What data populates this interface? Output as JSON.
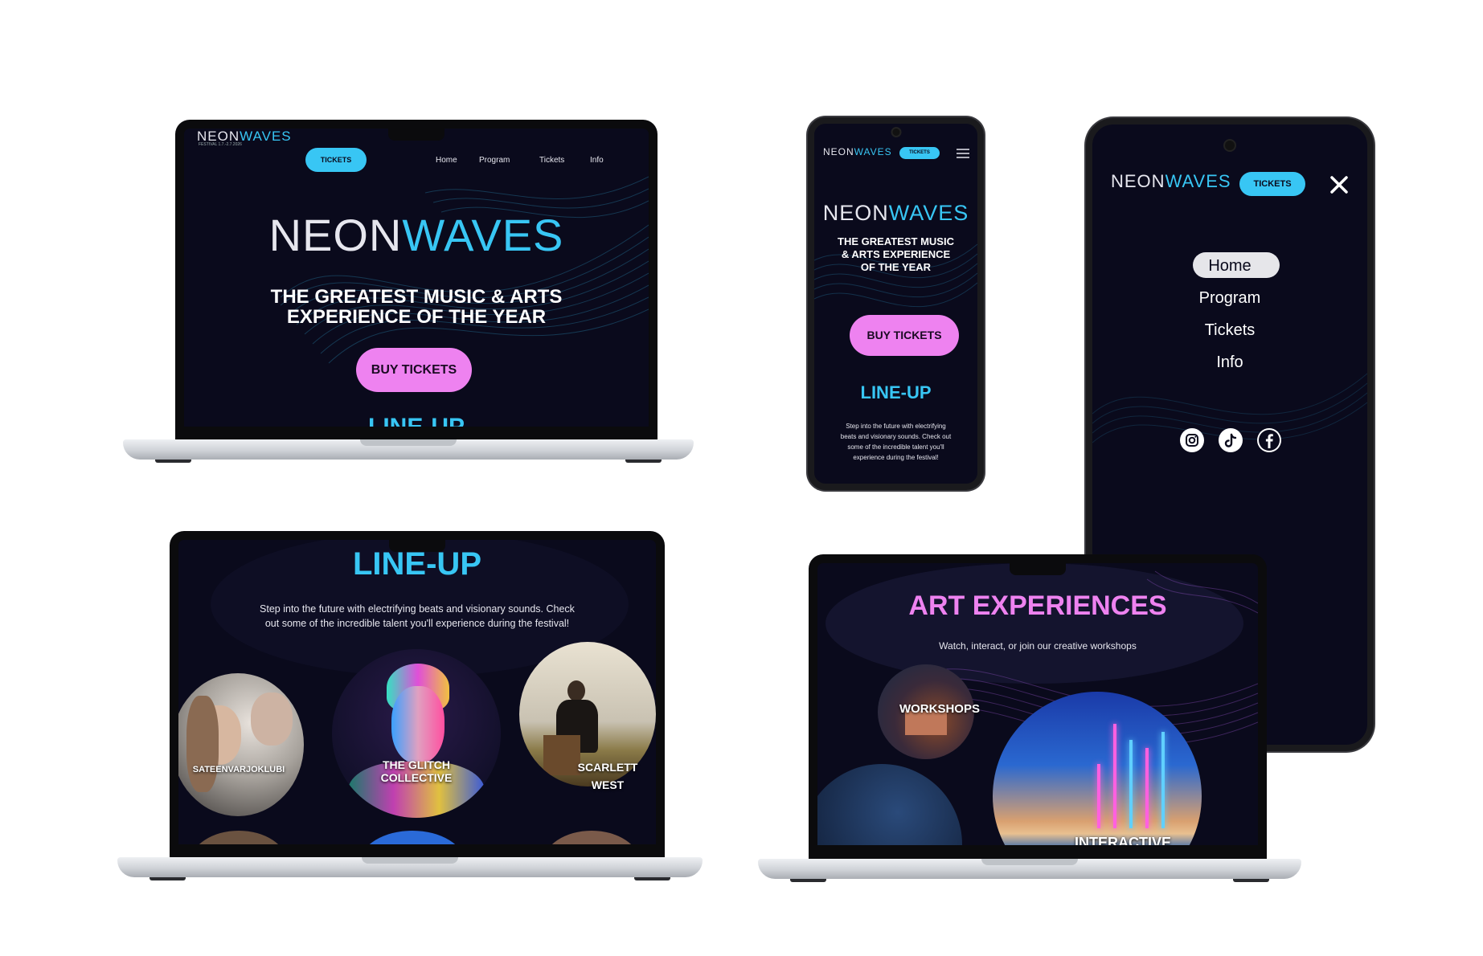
{
  "brand": {
    "neon": "NEON",
    "waves": "WAVES",
    "dates": "FESTIVAL 1.7.-2.7.2026"
  },
  "nav": {
    "tickets_button": "TICKETS",
    "home": "Home",
    "program": "Program",
    "tickets": "Tickets",
    "info": "Info"
  },
  "hero": {
    "tagline_line1": "THE GREATEST MUSIC & ARTS",
    "tagline_line2": "EXPERIENCE OF THE YEAR",
    "buy_button": "BUY TICKETS",
    "peek_text": "LINE-UP"
  },
  "mobile_hero": {
    "tagline_line1": "THE GREATEST MUSIC",
    "tagline_line2": "& ARTS EXPERIENCE",
    "tagline_line3": "OF THE YEAR",
    "buy_button": "BUY TICKETS",
    "lineup_title": "LINE-UP",
    "lineup_line1": "Step into the future with electrifying",
    "lineup_line2": "beats and visionary sounds. Check out",
    "lineup_line3": "some of the incredible talent you'll",
    "lineup_line4": "experience during the festival!"
  },
  "menu": {
    "items": [
      "Home",
      "Program",
      "Tickets",
      "Info"
    ],
    "active": "Home"
  },
  "lineup": {
    "title": "LINE-UP",
    "desc_line1": "Step into the future with electrifying beats and visionary sounds. Check",
    "desc_line2": "out some of the incredible talent you'll experience during the festival!",
    "artists": [
      "SATEENVARJOKLUBI",
      "THE GLITCH COLLECTIVE",
      "SCARLETT WEST"
    ],
    "artist2_line1": "THE GLITCH",
    "artist2_line2": "COLLECTIVE",
    "artist3_line1": "SCARLETT",
    "artist3_line2": "WEST"
  },
  "art": {
    "title": "ART EXPERIENCES",
    "subtitle": "Watch, interact, or join our creative workshops",
    "workshops": "WORKSHOPS",
    "interactive_peek": "INTERACTIVE"
  },
  "colors": {
    "bg": "#0a0a1c",
    "cyan": "#38c6f4",
    "pink": "#ee82f0"
  },
  "icons": [
    "instagram-icon",
    "tiktok-icon",
    "facebook-icon",
    "hamburger-icon",
    "close-icon"
  ]
}
